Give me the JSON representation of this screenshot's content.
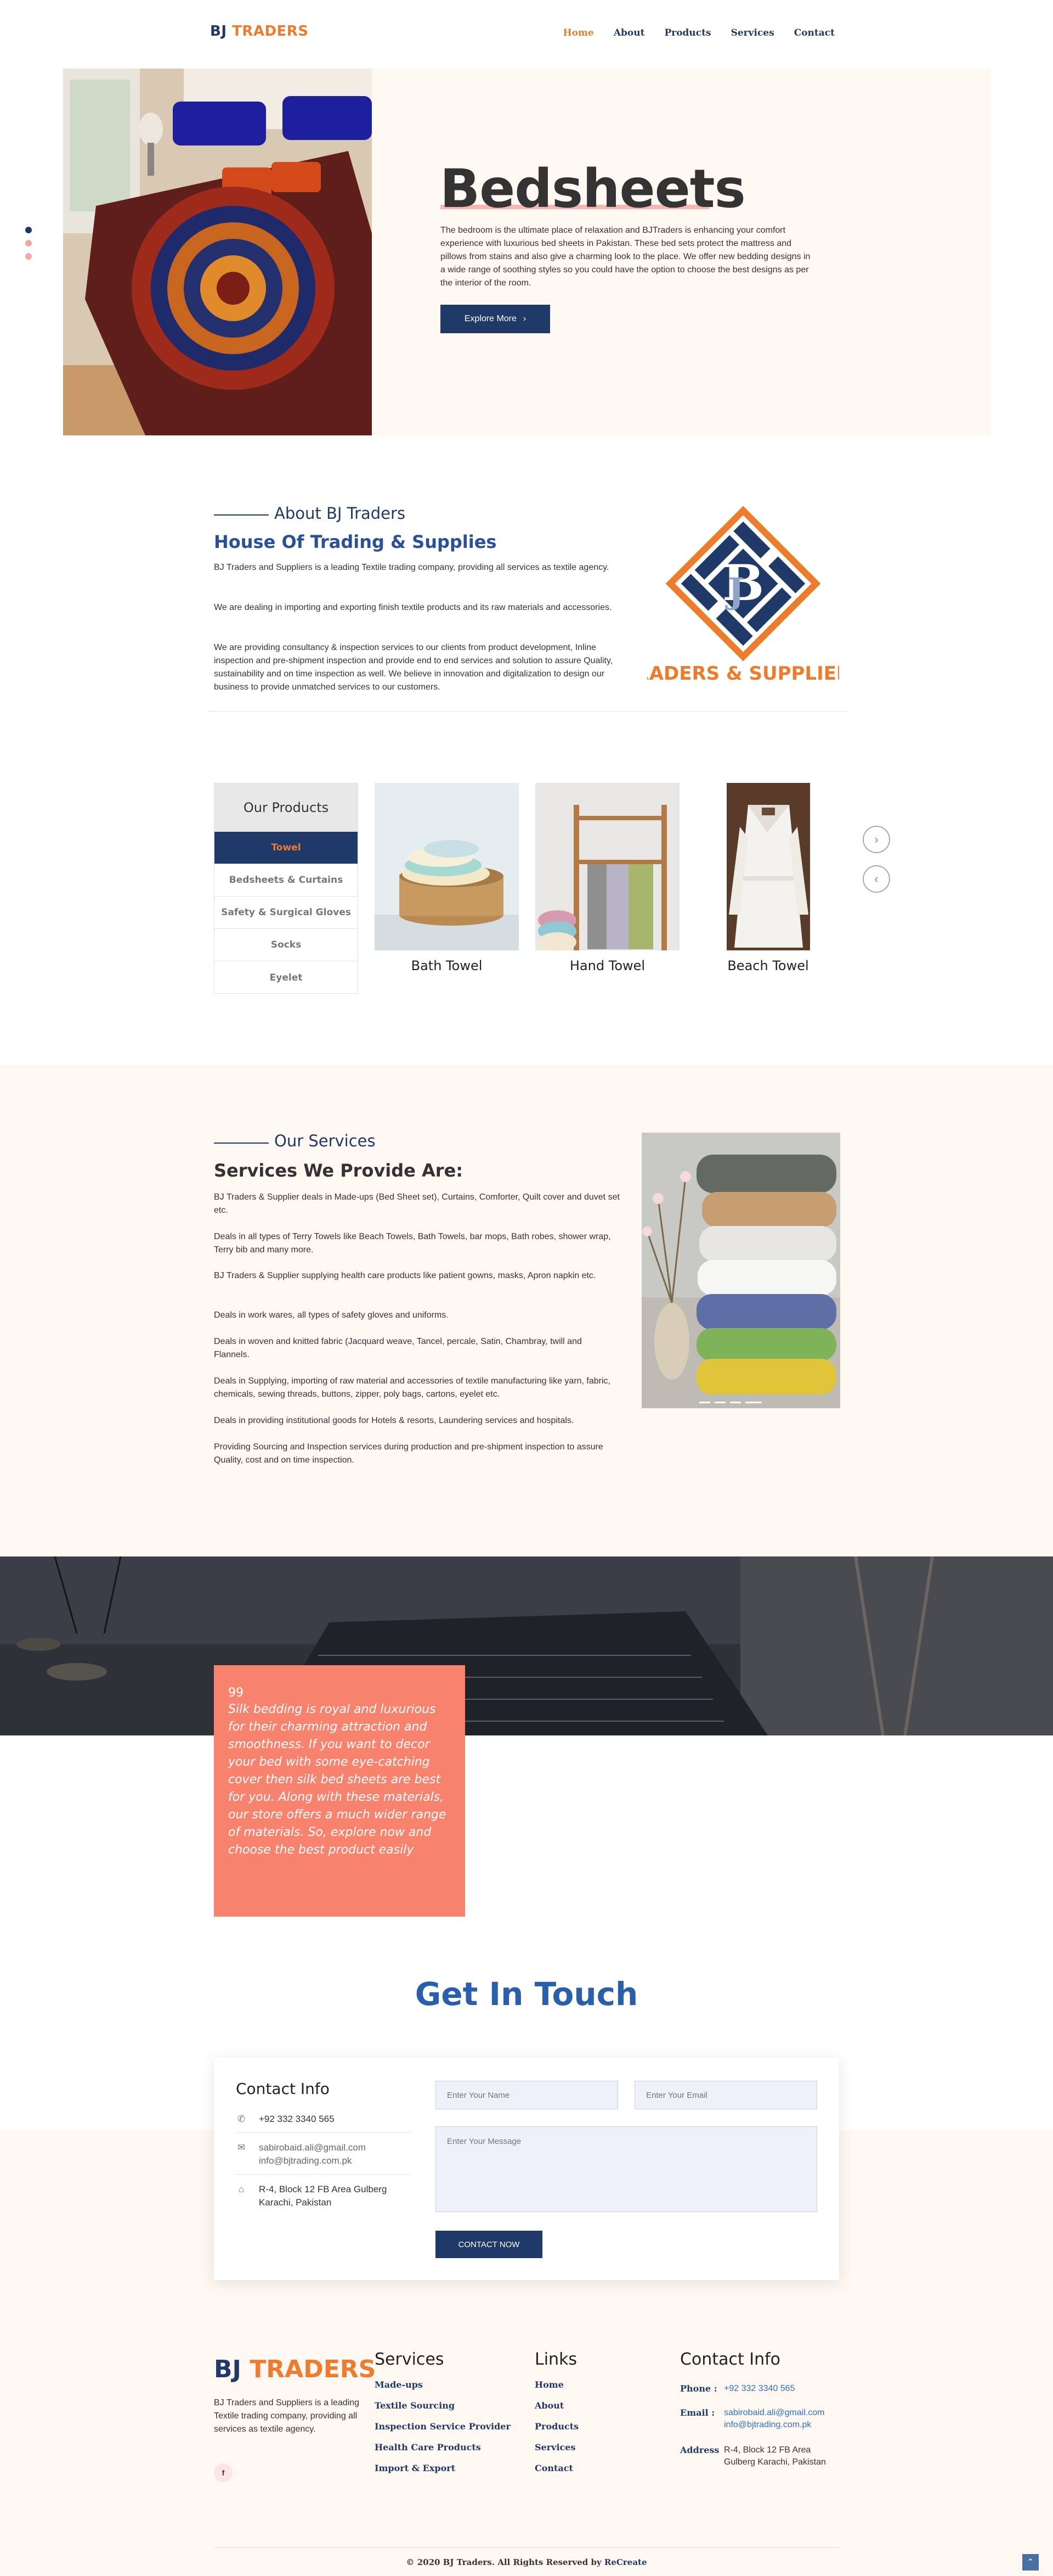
{
  "nav": {
    "logo_bj": "BJ",
    "logo_traders": "TRADERS",
    "items": [
      "Home",
      "About",
      "Products",
      "Services",
      "Contact"
    ]
  },
  "hero": {
    "title": "Bedsheets",
    "text": "The bedroom is the ultimate place of relaxation and BJTraders is enhancing your comfort experience with luxurious bed sheets in Pakistan. These bed sets protect the mattress and pillows from stains and also give a charming look to the place. We offer new bedding designs in a wide range of soothing styles so you could have the option to choose the best designs as per the interior of the room.",
    "button": "Explore More"
  },
  "about": {
    "kicker": "About BJ Traders",
    "title": "House Of Trading & Supplies",
    "paragraphs": [
      "BJ Traders and Suppliers is a leading Textile trading company, providing all services as textile agency.",
      "We are dealing in importing and exporting finish textile products and its raw materials and accessories.",
      "We are providing consultancy & inspection services to our clients from product development, Inline inspection and pre-shipment inspection and provide end to end services and solution to assure Quality, sustainability and on time inspection as well. We believe in innovation and digitalization to design our business to provide unmatched services to our customers."
    ],
    "logo_caption": "TRADERS & SUPPLIERS"
  },
  "products": {
    "heading": "Our Products",
    "categories": [
      "Towel",
      "Bedsheets & Curtains",
      "Safety & Surgical Gloves",
      "Socks",
      "Eyelet"
    ],
    "cards": [
      "Bath Towel",
      "Hand Towel",
      "Beach Towel"
    ]
  },
  "services": {
    "kicker": "Our Services",
    "title": "Services We Provide Are:",
    "paragraphs": [
      "BJ Traders & Supplier deals in Made-ups (Bed Sheet set), Curtains, Comforter, Quilt cover and duvet set etc.",
      "Deals in all types of Terry Towels like Beach Towels, Bath Towels, bar mops, Bath robes, shower wrap, Terry bib and many more.",
      "BJ Traders & Supplier supplying health care products like patient gowns, masks, Apron napkin etc.",
      "Deals in work wares, all types of safety gloves and uniforms.",
      "Deals in woven and knitted fabric (Jacquard weave, Tancel, percale, Satin, Chambray, twill and Flannels.",
      "Deals in Supplying, importing of raw material and accessories of textile manufacturing like yarn, fabric, chemicals, sewing threads, buttons, zipper, poly bags, cartons, eyelet etc.",
      "Deals in providing institutional goods for Hotels & resorts, Laundering services and hospitals.",
      "Providing Sourcing and Inspection services during production and pre-shipment inspection to assure Quality, cost and on time inspection."
    ]
  },
  "quote": {
    "mark": "99",
    "text": "Silk bedding is royal and luxurious for their charming attraction and smoothness. If you want to decor your bed with some eye-catching cover then silk bed sheets are best for you. Along with these materials, our store offers a much wider range of materials. So, explore now and choose the best product easily"
  },
  "contact": {
    "title": "Get In Touch",
    "info_title": "Contact Info",
    "phone": "+92 332 3340 565",
    "email1": "sabirobaid.ali@gmail.com",
    "email2": "info@bjtrading.com.pk",
    "address1": "R-4, Block 12 FB Area Gulberg",
    "address2": "Karachi, Pakistan",
    "name_placeholder": "Enter Your Name",
    "email_placeholder": "Enter Your Email",
    "message_placeholder": "Enter Your Message",
    "button": "CONTACT NOW"
  },
  "footer": {
    "logo_bj": "BJ",
    "logo_traders": "TRADERS",
    "about": "BJ Traders and Suppliers is a leading Textile trading company, providing all services as textile agency.",
    "social": "f",
    "services_title": "Services",
    "services": [
      "Made-ups",
      "Textile Sourcing",
      "Inspection Service Provider",
      "Health Care Products",
      "Import & Export"
    ],
    "links_title": "Links",
    "links": [
      "Home",
      "About",
      "Products",
      "Services",
      "Contact"
    ],
    "contact_title": "Contact Info",
    "phone_label": "Phone :",
    "phone": "+92 332 3340 565",
    "email_label": "Email :",
    "email1": "sabirobaid.ali@gmail.com",
    "email2": "info@bjtrading.com.pk",
    "address_label": "Address",
    "address1": "R-4, Block 12 FB Area",
    "address2": "Gulberg Karachi, Pakistan",
    "copyright": "© 2020 BJ Traders. All Rights Reserved by",
    "copyright_brand": "ReCreate"
  },
  "colors": {
    "navy": "#1f3a68",
    "orange": "#ef7b2c",
    "coral": "#f7826e",
    "cream": "#fff8f2",
    "link_blue": "#2a5fae"
  }
}
